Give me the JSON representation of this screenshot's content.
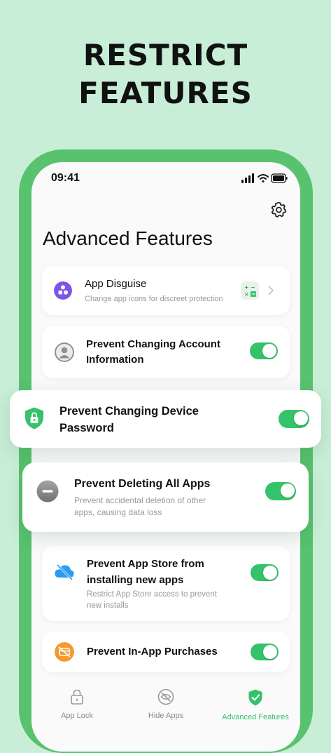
{
  "headline": {
    "line1": "RESTRICT",
    "line2": "FEATURES"
  },
  "status_bar": {
    "time": "09:41"
  },
  "screen": {
    "title": "Advanced Features"
  },
  "items": {
    "app_disguise": {
      "title": "App Disguise",
      "subtitle": "Change app icons for discreet protection"
    },
    "prevent_account": {
      "title_line1": "Prevent Changing Account",
      "title_line2": "Information",
      "toggle_on": true
    },
    "prevent_password": {
      "title_line1": "Prevent Changing Device",
      "title_line2": "Password",
      "toggle_on": true
    },
    "prevent_deleting": {
      "title": "Prevent Deleting All Apps",
      "subtitle_line1": "Prevent accidental deletion of other",
      "subtitle_line2": "apps, causing data loss",
      "toggle_on": true
    },
    "prevent_appstore": {
      "title_line1": "Prevent App Store from",
      "title_line2": "installing new apps",
      "subtitle_line1": "Restrict App Store access to prevent",
      "subtitle_line2": "new installs",
      "toggle_on": true
    },
    "prevent_iap": {
      "title": "Prevent In-App Purchases",
      "toggle_on": true
    }
  },
  "tabbar": {
    "tabs": [
      {
        "label": "App Lock",
        "icon": "lock-icon"
      },
      {
        "label": "Hide Apps",
        "icon": "eye-off-icon"
      },
      {
        "label": "Advanced Features",
        "icon": "shield-check-icon",
        "active": true
      }
    ]
  },
  "colors": {
    "accent": "#34c26a",
    "frame": "#58c26e",
    "background": "#c9eed7"
  }
}
